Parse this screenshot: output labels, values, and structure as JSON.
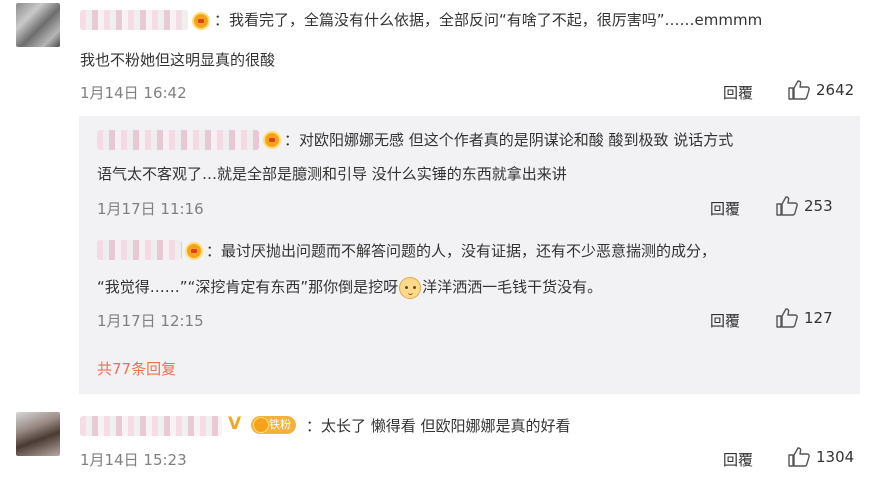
{
  "comments": [
    {
      "text_line1": "：我看完了，全篇没有什么依据，全部反问“有啥了不起，很厉害吗”……emmmm",
      "text_line2": "我也不粉她但这明显真的很酸",
      "date": "1月14日 16:42",
      "reply_label": "回覆",
      "likes": "2642"
    },
    {
      "text_line1": "：太长了 懒得看 但欧阳娜娜是真的好看",
      "date": "1月14日 15:23",
      "reply_label": "回覆",
      "likes": "1304",
      "vip_mark": "V",
      "fan_badge": "铁粉"
    }
  ],
  "sub_replies": [
    {
      "text_line1": "：对欧阳娜娜无感 但这个作者真的是阴谋论和酸 酸到极致 说话方式",
      "text_line2": "语气太不客观了…就是全部是臆测和引导 没什么实锤的东西就拿出来讲",
      "date": "1月17日 11:16",
      "reply_label": "回覆",
      "likes": "253"
    },
    {
      "text_line1": "：最讨厌抛出问题而不解答问题的人，没有证据，还有不少恶意揣测的成分，",
      "text_line2_before": "“我觉得……”“深挖肯定有东西”那你倒是挖呀",
      "text_line2_after": "洋洋洒洒一毛钱干货没有。",
      "emoji_name": "cat-face",
      "date": "1月17日 12:15",
      "reply_label": "回覆",
      "likes": "127"
    }
  ],
  "more_replies_label": "共77条回复",
  "colors": {
    "link": "#eb7350",
    "sub_bg": "#f2f2f5",
    "date": "#808080"
  },
  "icons": {
    "like": "thumbs-up-icon",
    "badge": "member-crown-icon"
  }
}
